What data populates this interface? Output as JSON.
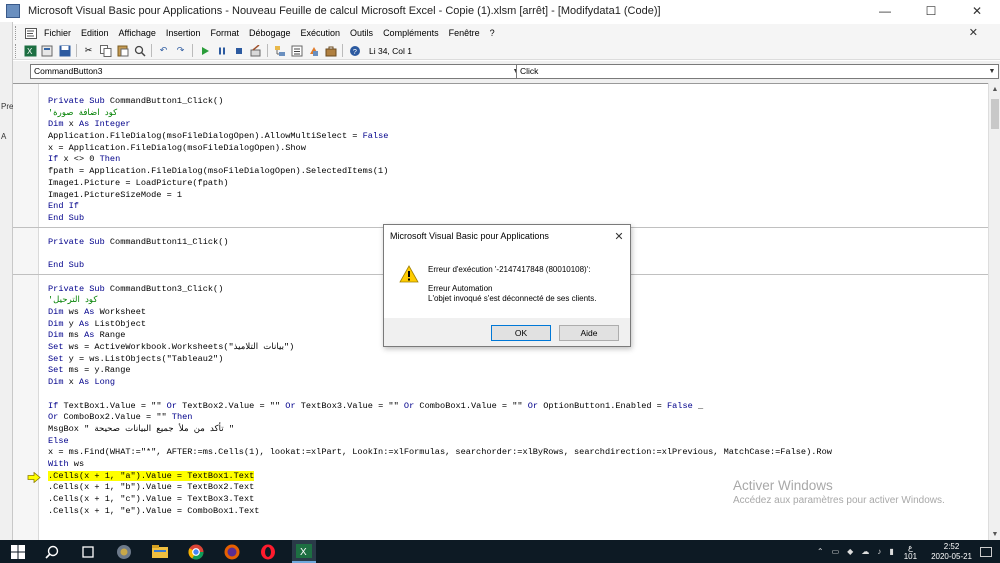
{
  "window": {
    "title": "Microsoft Visual Basic pour Applications - Nouveau Feuille de calcul Microsoft Excel - Copie (1).xlsm [arrêt] - [Modifydata1 (Code)]",
    "min_glyph": "—",
    "max_glyph": "☐",
    "close_glyph": "✕"
  },
  "left_strip": {
    "label_1": "Pre",
    "label_2": "A"
  },
  "menu": {
    "items": [
      "Fichier",
      "Edition",
      "Affichage",
      "Insertion",
      "Format",
      "Débogage",
      "Exécution",
      "Outils",
      "Compléments",
      "Fenêtre",
      "?"
    ],
    "close_glyph": "✕"
  },
  "toolbar": {
    "cursor_position": "Li 34, Col 1",
    "icons": [
      "excel-icon",
      "insert-module-icon",
      "save-icon",
      "cut-icon",
      "copy-icon",
      "paste-icon",
      "find-icon",
      "undo-icon",
      "redo-icon",
      "run-icon",
      "break-icon",
      "reset-icon",
      "design-mode-icon",
      "project-explorer-icon",
      "properties-icon",
      "object-browser-icon",
      "toolbox-icon",
      "help-icon"
    ]
  },
  "combos": {
    "object": "CommandButton3",
    "procedure": "Click"
  },
  "code": {
    "blocks": [
      [
        [
          {
            "t": "Private Sub",
            "c": "kw"
          },
          {
            "t": " CommandButton1_Click()"
          }
        ],
        [
          {
            "t": "'كود اضافة صورة",
            "c": "cm"
          }
        ],
        [
          {
            "t": "Dim",
            "c": "kw"
          },
          {
            "t": " x "
          },
          {
            "t": "As Integer",
            "c": "kw"
          }
        ],
        [
          {
            "t": "Application.FileDialog(msoFileDialogOpen).AllowMultiSelect = "
          },
          {
            "t": "False",
            "c": "kw"
          }
        ],
        [
          {
            "t": "x = Application.FileDialog(msoFileDialogOpen).Show"
          }
        ],
        [
          {
            "t": "If",
            "c": "kw"
          },
          {
            "t": " x <> 0 "
          },
          {
            "t": "Then",
            "c": "kw"
          }
        ],
        [
          {
            "t": "fpath = Application.FileDialog(msoFileDialogOpen).SelectedItems(1)"
          }
        ],
        [
          {
            "t": "Image1.Picture = LoadPicture(fpath)"
          }
        ],
        [
          {
            "t": "Image1.PictureSizeMode = 1"
          }
        ],
        [
          {
            "t": "End If",
            "c": "kw"
          }
        ],
        [
          {
            "t": "End Sub",
            "c": "kw"
          }
        ]
      ],
      [
        [
          {
            "t": "Private Sub",
            "c": "kw"
          },
          {
            "t": " CommandButton11_Click()"
          }
        ],
        [
          {
            "t": ""
          }
        ],
        [
          {
            "t": "End Sub",
            "c": "kw"
          }
        ]
      ],
      [
        [
          {
            "t": "Private Sub",
            "c": "kw"
          },
          {
            "t": " CommandButton3_Click()"
          }
        ],
        [
          {
            "t": "'كود الترحيل",
            "c": "cm"
          }
        ],
        [
          {
            "t": "Dim",
            "c": "kw"
          },
          {
            "t": " ws "
          },
          {
            "t": "As",
            "c": "kw"
          },
          {
            "t": " Worksheet"
          }
        ],
        [
          {
            "t": "Dim",
            "c": "kw"
          },
          {
            "t": " y "
          },
          {
            "t": "As",
            "c": "kw"
          },
          {
            "t": " ListObject"
          }
        ],
        [
          {
            "t": "Dim",
            "c": "kw"
          },
          {
            "t": " ms "
          },
          {
            "t": "As",
            "c": "kw"
          },
          {
            "t": " Range"
          }
        ],
        [
          {
            "t": "Set",
            "c": "kw"
          },
          {
            "t": " ws = ActiveWorkbook.Worksheets(\"بيانات التلاميذ\")"
          }
        ],
        [
          {
            "t": "Set",
            "c": "kw"
          },
          {
            "t": " y = ws.ListObjects(\"Tableau2\")"
          }
        ],
        [
          {
            "t": "Set",
            "c": "kw"
          },
          {
            "t": " ms = y.Range"
          }
        ],
        [
          {
            "t": "Dim",
            "c": "kw"
          },
          {
            "t": " x "
          },
          {
            "t": "As Long",
            "c": "kw"
          }
        ],
        [
          {
            "t": ""
          }
        ],
        [
          {
            "t": "If",
            "c": "kw"
          },
          {
            "t": " TextBox1.Value = \"\" "
          },
          {
            "t": "Or",
            "c": "kw"
          },
          {
            "t": " TextBox2.Value = \"\" "
          },
          {
            "t": "Or",
            "c": "kw"
          },
          {
            "t": " TextBox3.Value = \"\" "
          },
          {
            "t": "Or",
            "c": "kw"
          },
          {
            "t": " ComboBox1.Value = \"\" "
          },
          {
            "t": "Or",
            "c": "kw"
          },
          {
            "t": " OptionButton1.Enabled = "
          },
          {
            "t": "False",
            "c": "kw"
          },
          {
            "t": " _"
          }
        ],
        [
          {
            "t": "Or",
            "c": "kw"
          },
          {
            "t": " ComboBox2.Value = \"\" "
          },
          {
            "t": "Then",
            "c": "kw"
          }
        ],
        [
          {
            "t": "MsgBox \" تأكد من ملأ جميع البيانات صحيحة \""
          }
        ],
        [
          {
            "t": "Else",
            "c": "kw"
          }
        ],
        [
          {
            "t": "x = ms.Find(WHAT:=\"*\", AFTER:=ms.Cells(1), lookat:=xlPart, LookIn:=xlFormulas, searchorder:=xlByRows, searchdirection:=xlPrevious, MatchCase:=False).Row"
          }
        ],
        [
          {
            "t": "With",
            "c": "kw"
          },
          {
            "t": " ws"
          }
        ],
        [
          {
            "t": ".Cells(x + 1, \"a\").Value = TextBox1.Text",
            "c": "hl"
          }
        ],
        [
          {
            "t": ".Cells(x + 1, \"b\").Value = TextBox2.Text"
          }
        ],
        [
          {
            "t": ".Cells(x + 1, \"c\").Value = TextBox3.Text"
          }
        ],
        [
          {
            "t": ".Cells(x + 1, \"e\").Value = ComboBox1.Text"
          }
        ]
      ]
    ]
  },
  "watermark": {
    "title": "Activer Windows",
    "subtitle": "Accédez aux paramètres pour activer Windows."
  },
  "dialog": {
    "title": "Microsoft Visual Basic pour Applications",
    "close_glyph": "✕",
    "message_1": "Erreur d'exécution '-2147417848 (80010108)':",
    "message_2": "Erreur Automation",
    "message_3": "L'objet invoqué s'est déconnecté de ses clients.",
    "ok_label": "OK",
    "aide_label": "Aide"
  },
  "taskbar": {
    "lang_1": "ع",
    "lang_2": "101",
    "time": "2:52",
    "date": "2020-05-21",
    "tray_icons": [
      "chevron-up-icon",
      "network-icon",
      "dropbox-icon",
      "volume-icon",
      "battery-icon"
    ]
  }
}
